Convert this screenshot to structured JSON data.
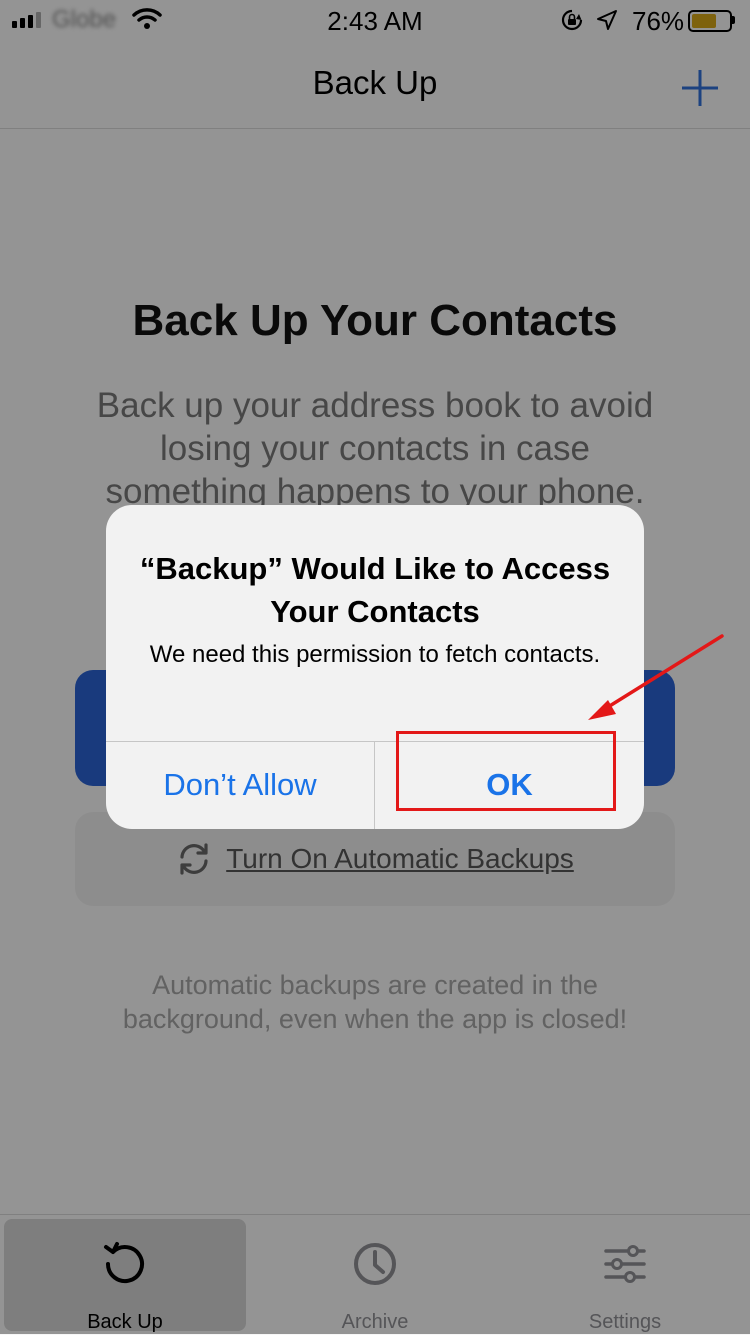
{
  "status_bar": {
    "carrier": "Globe",
    "time": "2:43 AM",
    "battery_percent": "76%",
    "battery_level": 0.76,
    "battery_color": "#d2a317"
  },
  "navbar": {
    "title": "Back Up",
    "add_icon": "plus-icon",
    "accent": "#1a73e8"
  },
  "content": {
    "heading": "Back Up Your Contacts",
    "description": "Back up your address book to avoid losing your contacts in case something happens to your phone.",
    "secondary_button_label": "Turn On Automatic Backups",
    "secondary_button_icon": "sync-icon",
    "footnote": "Automatic backups are created in the background, even when the app is closed!"
  },
  "tabbar": {
    "tabs": [
      {
        "label": "Back Up",
        "icon": "backup-icon",
        "active": true
      },
      {
        "label": "Archive",
        "icon": "clock-icon",
        "active": false
      },
      {
        "label": "Settings",
        "icon": "sliders-icon",
        "active": false
      }
    ]
  },
  "alert": {
    "title": "“Backup” Would Like to Access Your Contacts",
    "message": "We need this permission to fetch contacts.",
    "cancel_label": "Don’t Allow",
    "ok_label": "OK"
  },
  "annotation": {
    "highlight_color": "#e31818",
    "target": "OK"
  }
}
